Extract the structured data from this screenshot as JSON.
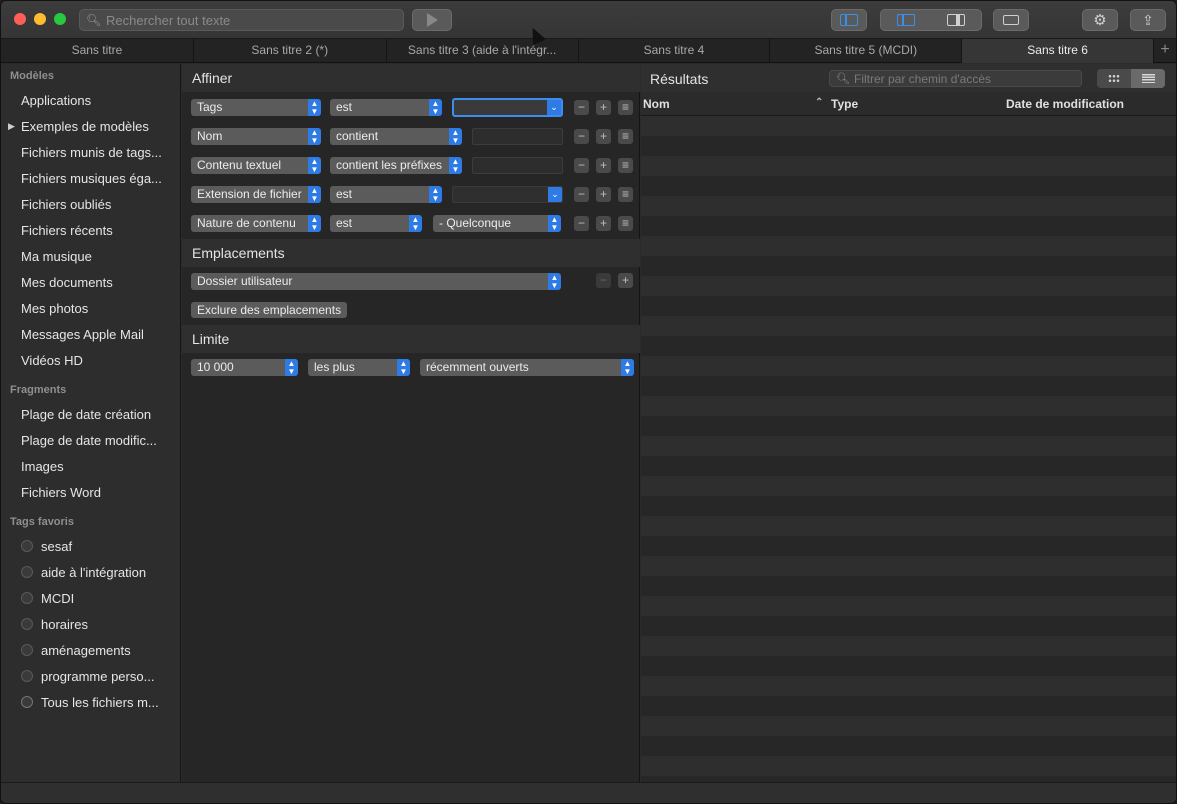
{
  "toolbar": {
    "search_placeholder": "Rechercher tout texte"
  },
  "tabs": [
    {
      "label": "Sans titre"
    },
    {
      "label": "Sans titre 2 (*)"
    },
    {
      "label": "Sans titre 3 (aide à l'intégr..."
    },
    {
      "label": "Sans titre 4"
    },
    {
      "label": "Sans titre 5 (MCDI)"
    },
    {
      "label": "Sans titre 6"
    }
  ],
  "sidebar": {
    "models_heading": "Modèles",
    "models": [
      {
        "label": "Applications"
      },
      {
        "label": "Exemples de modèles"
      },
      {
        "label": "Fichiers munis de tags..."
      },
      {
        "label": "Fichiers musiques éga..."
      },
      {
        "label": "Fichiers oubliés"
      },
      {
        "label": "Fichiers récents"
      },
      {
        "label": "Ma musique"
      },
      {
        "label": "Mes documents"
      },
      {
        "label": "Mes photos"
      },
      {
        "label": "Messages Apple Mail"
      },
      {
        "label": "Vidéos HD"
      }
    ],
    "fragments_heading": "Fragments",
    "fragments": [
      {
        "label": "Plage de date création"
      },
      {
        "label": "Plage de date modific..."
      },
      {
        "label": "Images"
      },
      {
        "label": "Fichiers Word"
      }
    ],
    "tags_heading": "Tags favoris",
    "tags": [
      {
        "label": "sesaf"
      },
      {
        "label": "aide à l'intégration"
      },
      {
        "label": "MCDI"
      },
      {
        "label": "horaires"
      },
      {
        "label": "aménagements"
      },
      {
        "label": "programme perso..."
      },
      {
        "label": "Tous les fichiers m..."
      }
    ]
  },
  "refine": {
    "heading": "Affiner",
    "rows": [
      {
        "attr": "Tags",
        "op": "est",
        "value": ""
      },
      {
        "attr": "Nom",
        "op": "contient",
        "value": ""
      },
      {
        "attr": "Contenu textuel",
        "op": "contient les préfixes",
        "value": ""
      },
      {
        "attr": "Extension de fichier",
        "op": "est",
        "value": ""
      },
      {
        "attr": "Nature de contenu",
        "op": "est",
        "value": "- Quelconque"
      }
    ]
  },
  "locations": {
    "heading": "Emplacements",
    "folder": "Dossier utilisateur",
    "exclude_label": "Exclure des emplacements"
  },
  "limit": {
    "heading": "Limite",
    "count": "10 000",
    "qualifier": "les plus",
    "order": "récemment ouverts"
  },
  "results": {
    "title": "Résultats",
    "filter_placeholder": "Filtrer par chemin d'accès",
    "columns": [
      "Nom",
      "Type",
      "Date de modification"
    ]
  }
}
